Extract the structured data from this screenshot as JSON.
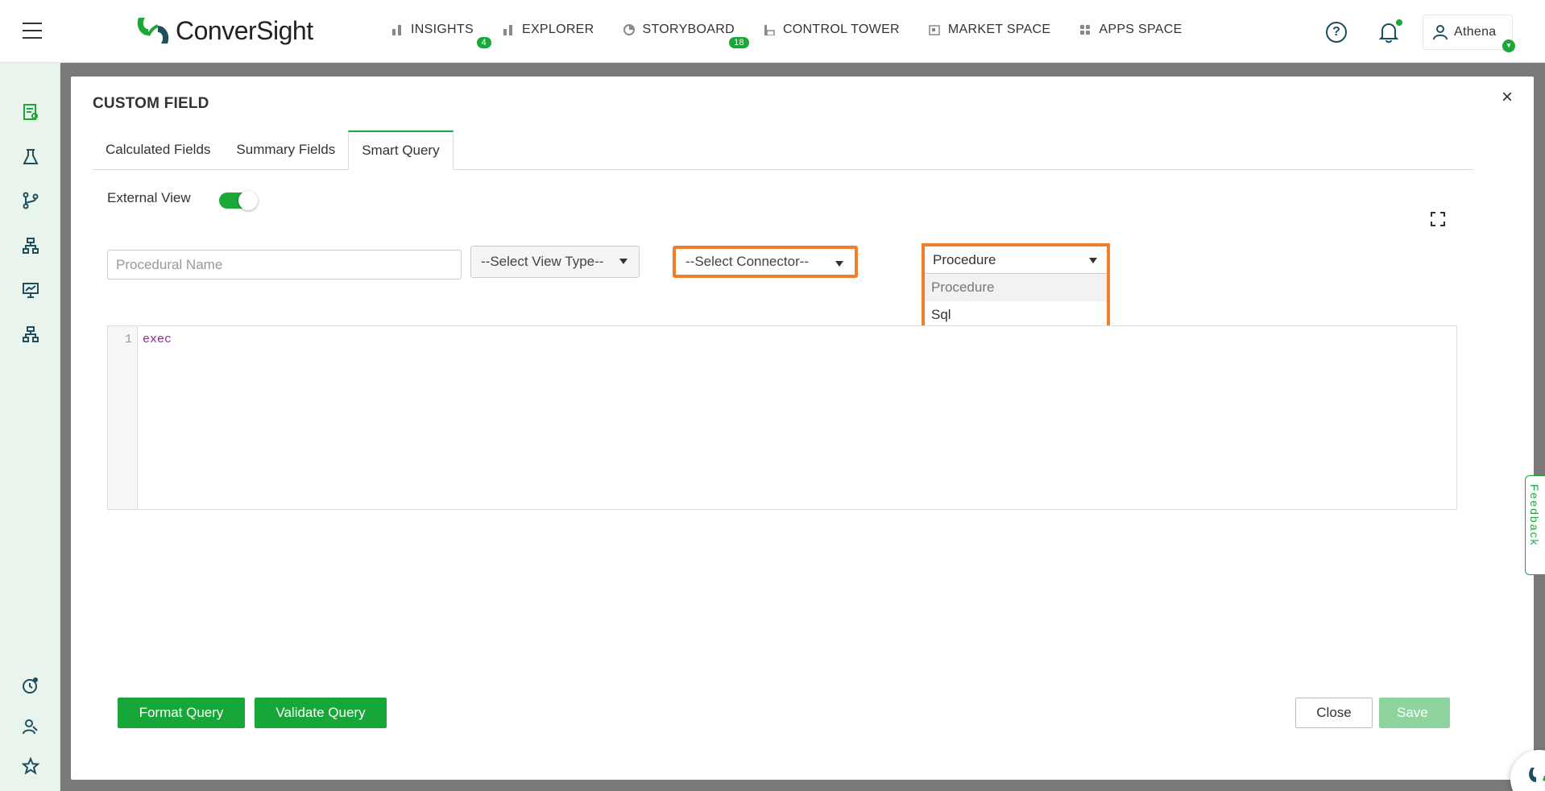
{
  "app": {
    "logo_text": "ConverSight",
    "brand_color": "#1aa838"
  },
  "nav": {
    "items": [
      {
        "label": "INSIGHTS",
        "icon": "bar-chart-icon",
        "badge": "4"
      },
      {
        "label": "EXPLORER",
        "icon": "bar-chart-icon",
        "badge": ""
      },
      {
        "label": "STORYBOARD",
        "icon": "pie-chart-icon",
        "badge": "18"
      },
      {
        "label": "CONTROL TOWER",
        "icon": "tower-icon",
        "badge": ""
      },
      {
        "label": "MARKET SPACE",
        "icon": "store-icon",
        "badge": ""
      },
      {
        "label": "APPS SPACE",
        "icon": "apps-grid-icon",
        "badge": ""
      }
    ],
    "user_name": "Athena"
  },
  "sidebar": {
    "icons": [
      "menu-icon",
      "report-icon",
      "flask-icon",
      "branch-icon",
      "hierarchy-icon",
      "presentation-chart-icon",
      "org-chart-icon",
      "clock-gear-icon",
      "user-search-icon",
      "star-icon"
    ]
  },
  "modal": {
    "title": "CUSTOM FIELD",
    "close_glyph": "×",
    "tabs": [
      {
        "label": "Calculated Fields",
        "active": false
      },
      {
        "label": "Summary Fields",
        "active": false
      },
      {
        "label": "Smart Query",
        "active": true
      }
    ],
    "external_view_label": "External View",
    "external_view_on": true,
    "procedural_name_placeholder": "Procedural Name",
    "view_type_value": "--Select View Type--",
    "connector_value": "--Select Connector--",
    "procedure_select": {
      "value": "Procedure",
      "options": [
        "Procedure",
        "Sql"
      ]
    },
    "editor": {
      "line_number": "1",
      "code": "exec"
    },
    "buttons": {
      "format": "Format Query",
      "validate": "Validate Query",
      "close": "Close",
      "save": "Save"
    }
  },
  "feedback_label": "Feedback"
}
